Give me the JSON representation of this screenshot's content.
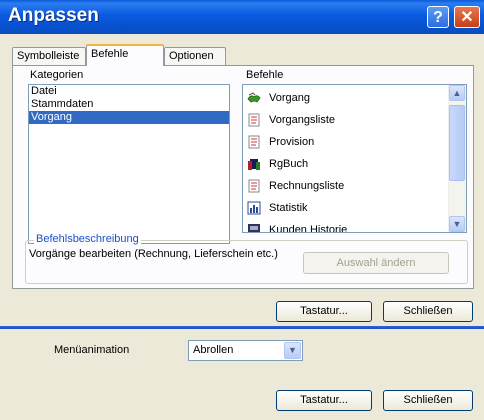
{
  "window": {
    "title": "Anpassen",
    "help_glyph": "?",
    "close_glyph": "✕"
  },
  "tabs": [
    {
      "label": "Symbolleiste"
    },
    {
      "label": "Befehle"
    },
    {
      "label": "Optionen"
    }
  ],
  "categories": {
    "heading": "Kategorien",
    "items": [
      "Datei",
      "Stammdaten",
      "Vorgang"
    ],
    "selected": "Vorgang"
  },
  "commands": {
    "heading": "Befehle",
    "items": [
      {
        "label": "Vorgang",
        "icon": "handshake-icon"
      },
      {
        "label": "Vorgangsliste",
        "icon": "document-list-icon"
      },
      {
        "label": "Provision",
        "icon": "document-list-icon"
      },
      {
        "label": "RgBuch",
        "icon": "book-icon"
      },
      {
        "label": "Rechnungsliste",
        "icon": "document-list-icon"
      },
      {
        "label": "Statistik",
        "icon": "chart-icon"
      },
      {
        "label": "Kunden Historie",
        "icon": "history-icon"
      }
    ]
  },
  "description": {
    "title": "Befehlsbeschreibung",
    "text": "Vorgänge bearbeiten (Rechnung, Lieferschein etc.)",
    "change_button": "Auswahl ändern"
  },
  "buttons": {
    "keyboard": "Tastatur...",
    "close": "Schließen"
  },
  "options": {
    "animation_label": "Menüanimation",
    "animation_value": "Abrollen"
  },
  "colors": {
    "title_bar": "#0a5bd6",
    "selection": "#316ac5",
    "group_title": "#1d52c9"
  }
}
